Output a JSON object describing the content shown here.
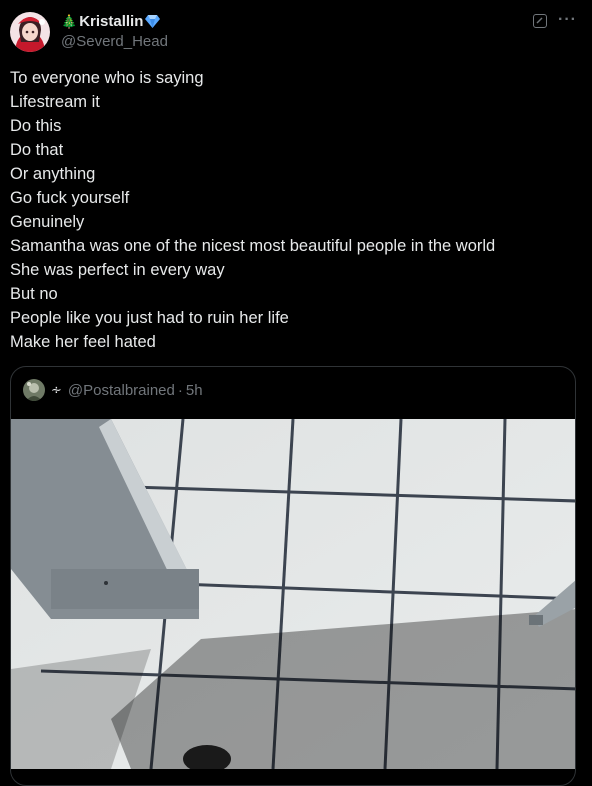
{
  "author": {
    "display_name": "Kristallin",
    "name_prefix_emoji": "🎄",
    "name_suffix_emoji": "💎",
    "handle": "@Severd_Head"
  },
  "header_icons": {
    "edit": "edit-square-icon",
    "more": "more-horizontal-icon",
    "more_glyph": "···"
  },
  "tweet": {
    "lines": [
      "To everyone who is saying",
      "Lifestream it",
      "Do this",
      "Do that",
      "Or anything",
      "Go fuck yourself",
      "Genuinely",
      "Samantha was one of the nicest most beautiful people in the world",
      "She was perfect in every way",
      "But no",
      "People like you just had to ruin her life",
      "Make her feel hated"
    ]
  },
  "quote": {
    "badge_glyph": "∻",
    "handle": "@Postalbrained",
    "separator": "·",
    "time": "5h",
    "media": "photo-of-tiled-floor-with-stall-partition"
  },
  "colors": {
    "background": "#000000",
    "text_primary": "#e7e9ea",
    "text_secondary": "#71767b",
    "border": "#2f3336",
    "verified_gem": "#5aa9ff"
  }
}
